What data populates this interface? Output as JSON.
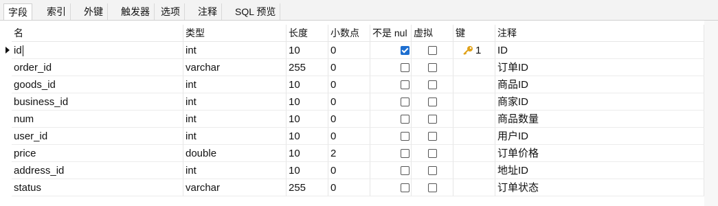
{
  "tabs": [
    "字段",
    "索引",
    "外键",
    "触发器",
    "选项",
    "注释",
    "SQL 预览"
  ],
  "columns": {
    "name": "名",
    "type": "类型",
    "length": "长度",
    "decimals": "小数点",
    "not_null": "不是 nul",
    "virtual": "虚拟",
    "key": "键",
    "comment": "注释"
  },
  "rows": [
    {
      "name": "id",
      "type": "int",
      "length": "10",
      "decimals": "0",
      "not_null": true,
      "virtual": false,
      "key": "1",
      "comment": "ID"
    },
    {
      "name": "order_id",
      "type": "varchar",
      "length": "255",
      "decimals": "0",
      "not_null": false,
      "virtual": false,
      "key": "",
      "comment": "订单ID"
    },
    {
      "name": "goods_id",
      "type": "int",
      "length": "10",
      "decimals": "0",
      "not_null": false,
      "virtual": false,
      "key": "",
      "comment": "商品ID"
    },
    {
      "name": "business_id",
      "type": "int",
      "length": "10",
      "decimals": "0",
      "not_null": false,
      "virtual": false,
      "key": "",
      "comment": "商家ID"
    },
    {
      "name": "num",
      "type": "int",
      "length": "10",
      "decimals": "0",
      "not_null": false,
      "virtual": false,
      "key": "",
      "comment": "商品数量"
    },
    {
      "name": "user_id",
      "type": "int",
      "length": "10",
      "decimals": "0",
      "not_null": false,
      "virtual": false,
      "key": "",
      "comment": "用户ID"
    },
    {
      "name": "price",
      "type": "double",
      "length": "10",
      "decimals": "2",
      "not_null": false,
      "virtual": false,
      "key": "",
      "comment": "订单价格"
    },
    {
      "name": "address_id",
      "type": "int",
      "length": "10",
      "decimals": "0",
      "not_null": false,
      "virtual": false,
      "key": "",
      "comment": "地址ID"
    },
    {
      "name": "status",
      "type": "varchar",
      "length": "255",
      "decimals": "0",
      "not_null": false,
      "virtual": false,
      "key": "",
      "comment": "订单状态"
    }
  ],
  "selected_row": 0,
  "colors": {
    "accent": "#1e6fd0",
    "key_icon": "#e0a21a"
  },
  "icons": {
    "key": "key-icon",
    "row_marker": "row-pointer-icon"
  }
}
